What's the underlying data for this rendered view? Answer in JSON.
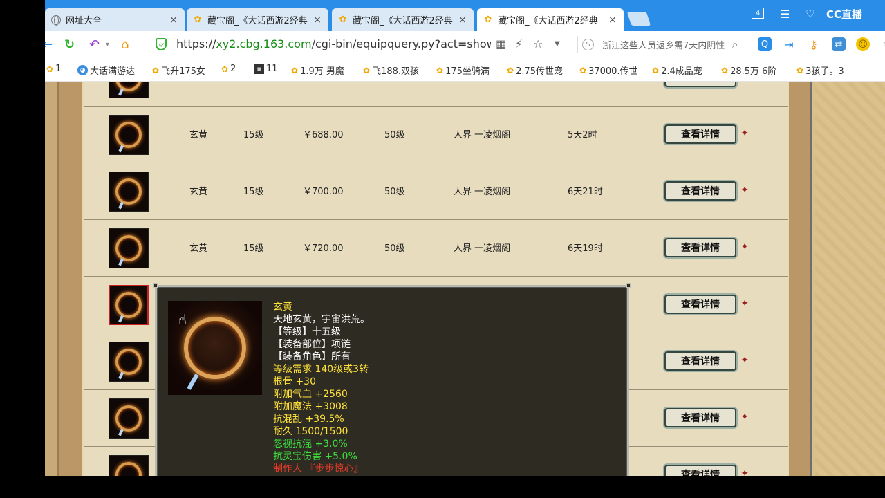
{
  "tabs": [
    {
      "icon": "globe-icon",
      "label": "网址大全",
      "active": false
    },
    {
      "icon": "chick-icon",
      "label": "藏宝阁_《大话西游2经典",
      "active": false
    },
    {
      "icon": "chick-icon",
      "label": "藏宝阁_《大话西游2经典",
      "active": false
    },
    {
      "icon": "chick-icon",
      "label": "藏宝阁_《大话西游2经典",
      "active": true
    }
  ],
  "tab_close": "×",
  "toolbar": {
    "window_count": "4",
    "brand": "CC直播"
  },
  "address": {
    "url_protocol": "https://",
    "url_domain": "xy2.cbg.163.com",
    "url_path": "/cgi-bin/equipquery.py?act=show_ov",
    "search_placeholder": "浙江这些人员返乡需7天内阴性"
  },
  "bookmarks": [
    {
      "icon": "chick-icon",
      "label": "1"
    },
    {
      "icon": "face-icon",
      "label": "大话满游达"
    },
    {
      "icon": "chick-icon",
      "label": "飞升175女"
    },
    {
      "icon": "chick-icon",
      "label": "2"
    },
    {
      "icon": "square-icon",
      "label": "11"
    },
    {
      "icon": "chick-icon",
      "label": "1.9万 男魔"
    },
    {
      "icon": "chick-icon",
      "label": "飞188.双孩"
    },
    {
      "icon": "chick-icon",
      "label": "175坐骑满"
    },
    {
      "icon": "chick-icon",
      "label": "2.75传世宠"
    },
    {
      "icon": "chick-icon",
      "label": "37000.传世"
    },
    {
      "icon": "chick-icon",
      "label": "2.4成品宠"
    },
    {
      "icon": "chick-icon",
      "label": "28.5万 6阶"
    },
    {
      "icon": "chick-icon",
      "label": "3孩子。3"
    }
  ],
  "listing": {
    "detail_label": "查看详情",
    "rows": [
      {
        "name": "",
        "level": "",
        "price": "",
        "req": "",
        "server": "",
        "time": ""
      },
      {
        "name": "玄黄",
        "level": "15级",
        "price": "￥688.00",
        "req": "50级",
        "server": "人界 一凌烟阁",
        "time": "5天2时"
      },
      {
        "name": "玄黄",
        "level": "15级",
        "price": "￥700.00",
        "req": "50级",
        "server": "人界 一凌烟阁",
        "time": "6天21时"
      },
      {
        "name": "玄黄",
        "level": "15级",
        "price": "￥720.00",
        "req": "50级",
        "server": "人界 一凌烟阁",
        "time": "6天19时"
      },
      {
        "name": "",
        "level": "",
        "price": "",
        "req": "",
        "server": "",
        "time": ""
      },
      {
        "name": "",
        "level": "",
        "price": "",
        "req": "",
        "server": "",
        "time": ""
      },
      {
        "name": "",
        "level": "",
        "price": "",
        "req": "",
        "server": "",
        "time": ""
      },
      {
        "name": "",
        "level": "",
        "price": "",
        "req": "",
        "server": "",
        "time": ""
      }
    ]
  },
  "tooltip": {
    "lines": [
      {
        "text": "玄黄",
        "color": "#ffe23a"
      },
      {
        "text": "天地玄黄，宇宙洪荒。",
        "color": "#ffffff"
      },
      {
        "text": "【等级】十五级",
        "color": "#ffffff"
      },
      {
        "text": "【装备部位】项链",
        "color": "#ffffff"
      },
      {
        "text": "【装备角色】所有",
        "color": "#ffffff"
      },
      {
        "text": "等级需求 140级或3转",
        "color": "#ffe23a"
      },
      {
        "text": "根骨 +30",
        "color": "#ffe23a"
      },
      {
        "text": "附加气血 +2560",
        "color": "#ffe23a"
      },
      {
        "text": "附加魔法 +3008",
        "color": "#ffe23a"
      },
      {
        "text": "抗混乱 +39.5%",
        "color": "#ffe23a"
      },
      {
        "text": "耐久 1500/1500",
        "color": "#ffe23a"
      },
      {
        "text": "忽视抗混 +3.0%",
        "color": "#3ee03e"
      },
      {
        "text": "抗灵宝伤害 +5.0%",
        "color": "#3ee03e"
      },
      {
        "text": "制作人 『步步惊心』",
        "color": "#e83a2a"
      }
    ]
  }
}
